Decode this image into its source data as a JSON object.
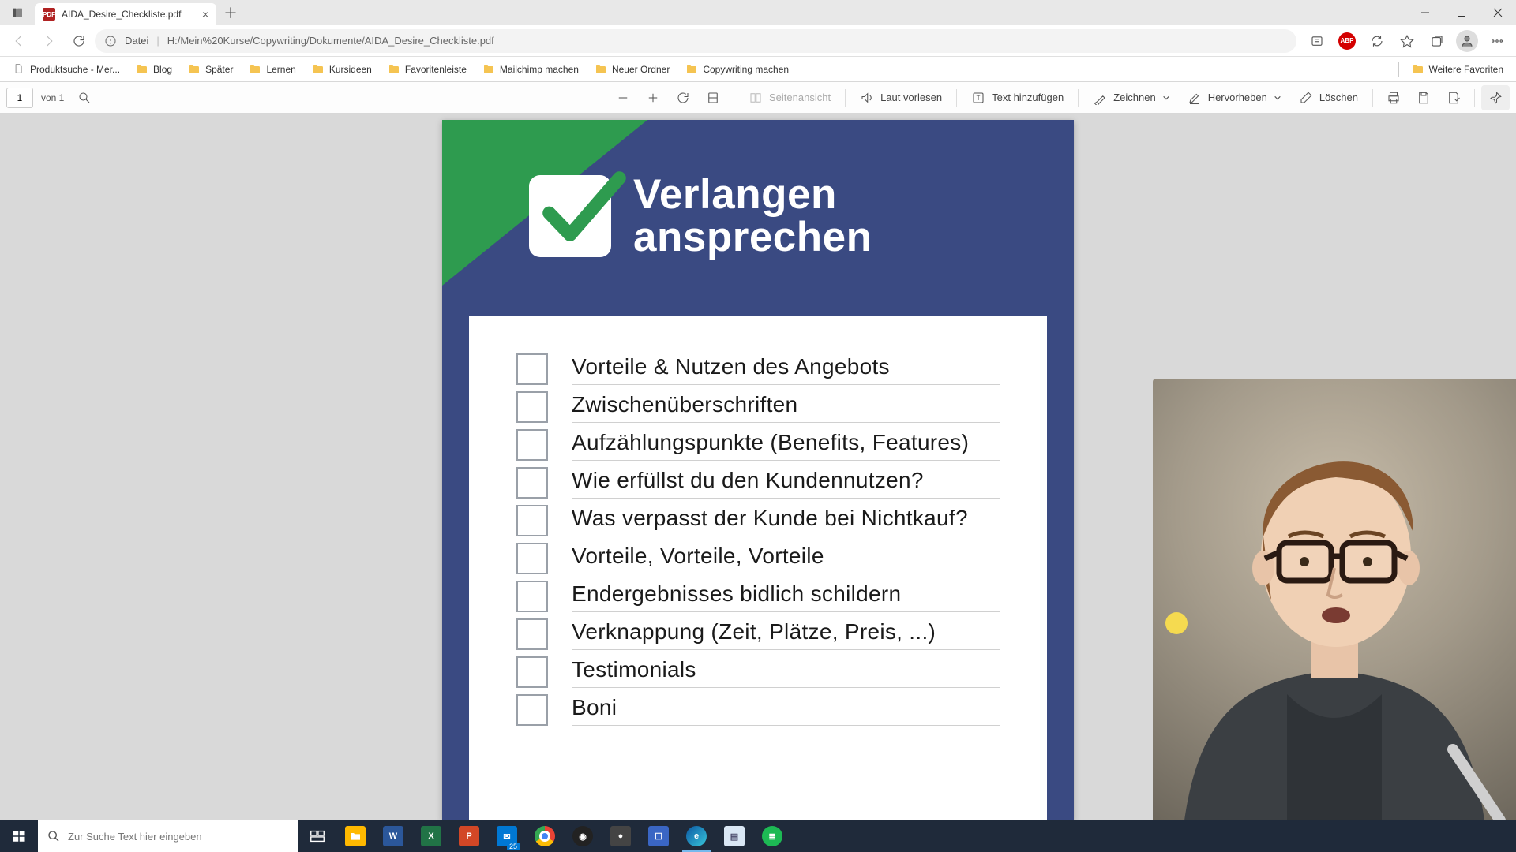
{
  "tab": {
    "title": "AIDA_Desire_Checkliste.pdf"
  },
  "address": {
    "scheme": "Datei",
    "path": "H:/Mein%20Kurse/Copywriting/Dokumente/AIDA_Desire_Checkliste.pdf"
  },
  "bookmarks": {
    "items": [
      {
        "label": "Produktsuche - Mer...",
        "type": "page"
      },
      {
        "label": "Blog",
        "type": "folder"
      },
      {
        "label": "Später",
        "type": "folder"
      },
      {
        "label": "Lernen",
        "type": "folder"
      },
      {
        "label": "Kursideen",
        "type": "folder"
      },
      {
        "label": "Favoritenleiste",
        "type": "folder"
      },
      {
        "label": "Mailchimp machen",
        "type": "folder"
      },
      {
        "label": "Neuer Ordner",
        "type": "folder"
      },
      {
        "label": "Copywriting machen",
        "type": "folder"
      }
    ],
    "overflow": "Weitere Favoriten"
  },
  "pdf_toolbar": {
    "page_current": "1",
    "page_of": "von 1",
    "page_view": "Seitenansicht",
    "read_aloud": "Laut vorlesen",
    "add_text": "Text hinzufügen",
    "draw": "Zeichnen",
    "highlight": "Hervorheben",
    "erase": "Löschen"
  },
  "document": {
    "title_line1": "Verlangen",
    "title_line2": "ansprechen",
    "items": [
      "Vorteile & Nutzen des Angebots",
      "Zwischenüberschriften",
      "Aufzählungspunkte (Benefits, Features)",
      "Wie erfüllst du den Kundennutzen?",
      "Was verpasst der Kunde bei Nichtkauf?",
      "Vorteile, Vorteile, Vorteile",
      "Endergebnisses bidlich schildern",
      "Verknappung (Zeit, Plätze, Preis, ...)",
      "Testimonials",
      "Boni"
    ]
  },
  "taskbar": {
    "search_placeholder": "Zur Suche Text hier eingeben",
    "date_badge": "25"
  },
  "colors": {
    "pdf_header": "#3a4a82",
    "pdf_accent": "#2e9b4f"
  }
}
